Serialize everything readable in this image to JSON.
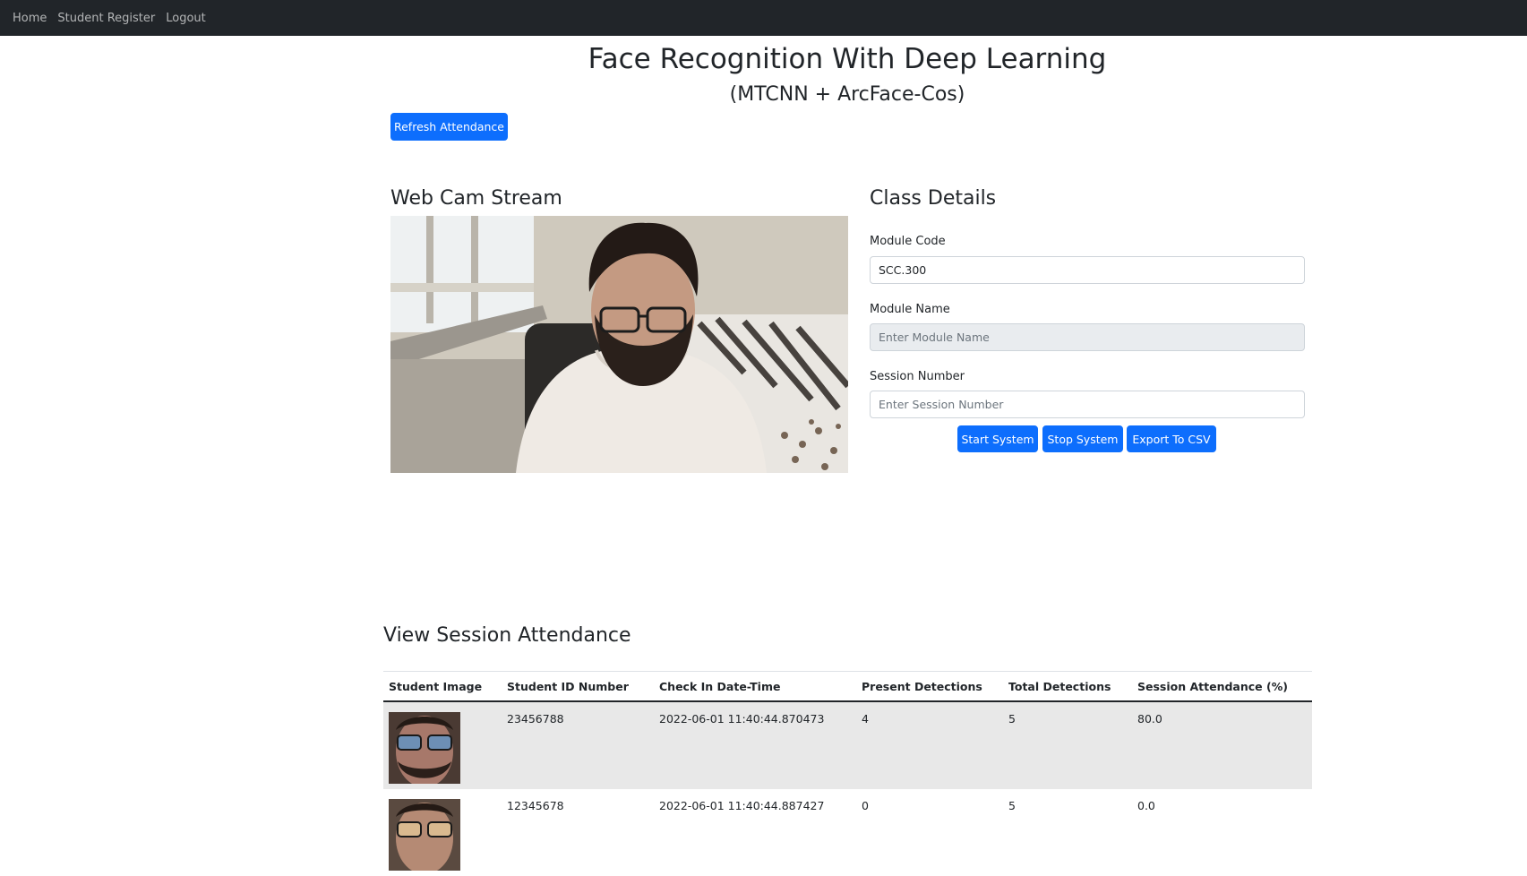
{
  "nav": {
    "items": [
      {
        "label": "Home"
      },
      {
        "label": "Student Register"
      },
      {
        "label": "Logout"
      }
    ]
  },
  "header": {
    "title": "Face Recognition With Deep Learning",
    "subtitle": "(MTCNN + ArcFace-Cos)"
  },
  "toolbar": {
    "refresh_label": "Refresh Attendance"
  },
  "webcam": {
    "heading": "Web Cam Stream"
  },
  "class_details": {
    "heading": "Class Details",
    "module_code": {
      "label": "Module Code",
      "value": "SCC.300"
    },
    "module_name": {
      "label": "Module Name",
      "placeholder": "Enter Module Name",
      "value": ""
    },
    "session_number": {
      "label": "Session Number",
      "placeholder": "Enter Session Number",
      "value": ""
    },
    "buttons": {
      "start": "Start System",
      "stop": "Stop System",
      "export": "Export To CSV"
    }
  },
  "attendance": {
    "heading": "View Session Attendance",
    "columns": [
      "Student Image",
      "Student ID Number",
      "Check In Date-Time",
      "Present Detections",
      "Total Detections",
      "Session Attendance (%)"
    ],
    "rows": [
      {
        "student_id": "23456788",
        "check_in": "2022-06-01 11:40:44.870473",
        "present": "4",
        "total": "5",
        "attendance": "80.0"
      },
      {
        "student_id": "12345678",
        "check_in": "2022-06-01 11:40:44.887427",
        "present": "0",
        "total": "5",
        "attendance": "0.0"
      }
    ]
  },
  "colors": {
    "navbar": "#212529",
    "primary": "#0d6efd",
    "striped_row": "#e8e8e8",
    "disabled_input": "#e9ecef"
  }
}
